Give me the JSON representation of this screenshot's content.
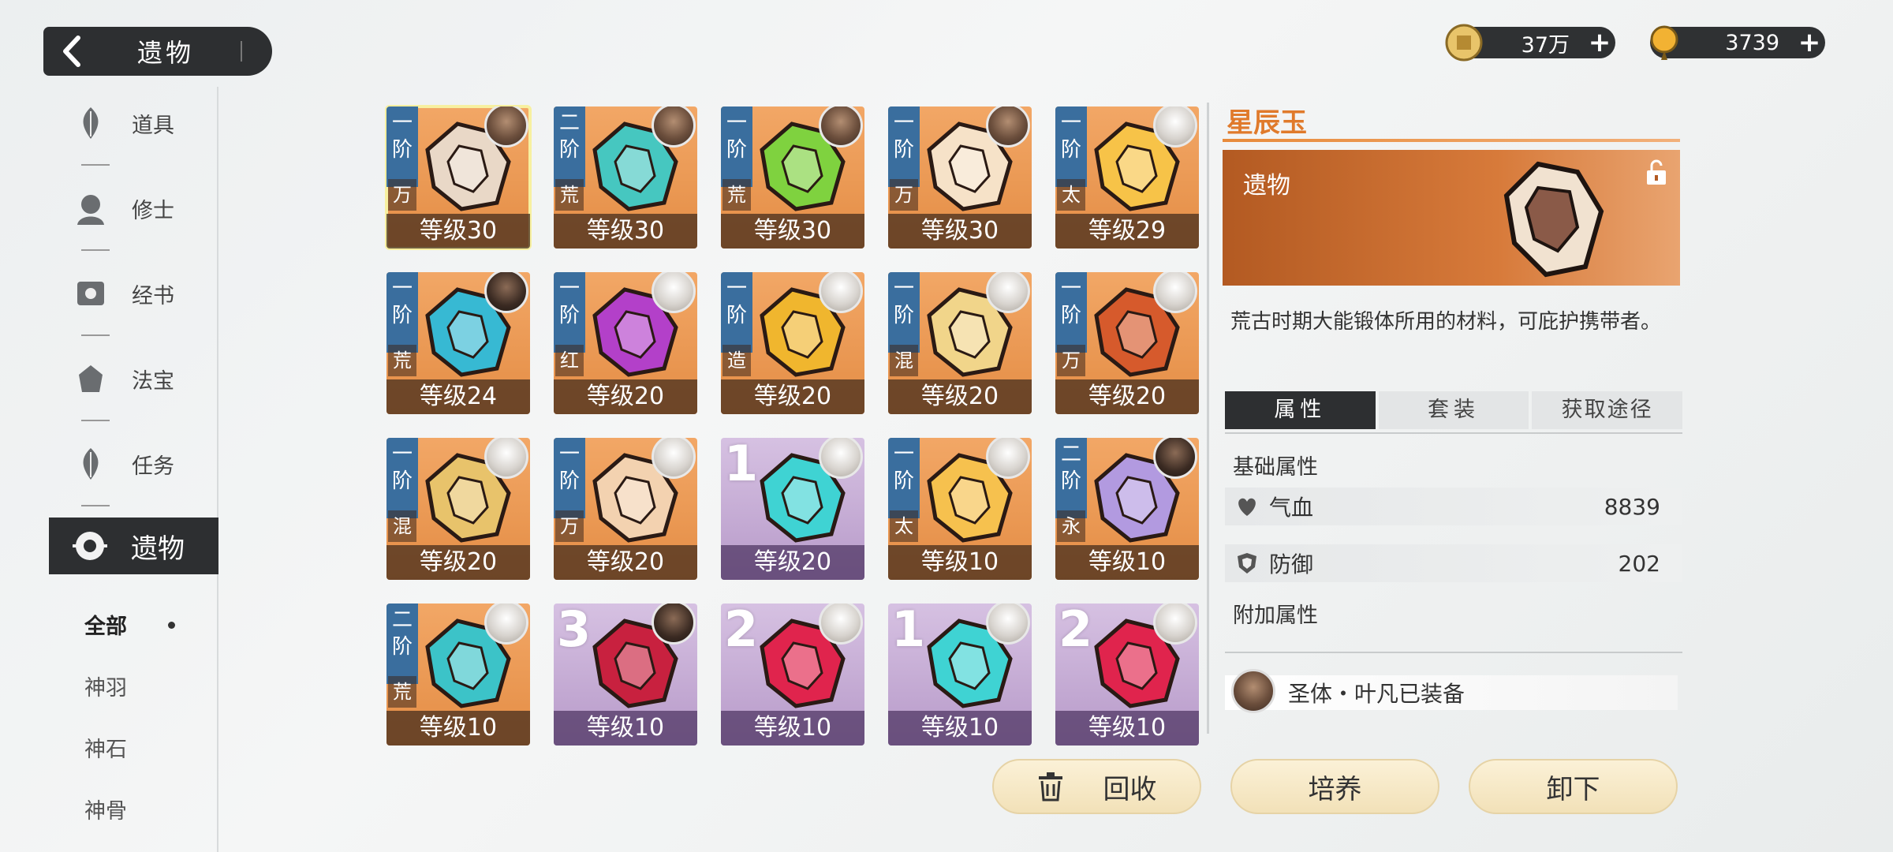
{
  "header": {
    "title": "遗物"
  },
  "currencies": [
    {
      "icon": "gold-coin-icon",
      "value": "37万"
    },
    {
      "icon": "gem-drop-icon",
      "value": "3739"
    }
  ],
  "sidebar": {
    "items": [
      {
        "label": "道具",
        "icon": "leaf-icon"
      },
      {
        "label": "修士",
        "icon": "cultivator-icon"
      },
      {
        "label": "经书",
        "icon": "scroll-icon"
      },
      {
        "label": "法宝",
        "icon": "treasure-icon"
      },
      {
        "label": "任务",
        "icon": "leaf-icon"
      },
      {
        "label": "遗物",
        "icon": "relic-icon"
      }
    ],
    "subitems": [
      "全部",
      "神羽",
      "神石",
      "神骨"
    ]
  },
  "grid": [
    {
      "tier": "一阶",
      "tag": "万",
      "level": "等级30",
      "color": "orange",
      "selected": true,
      "avatar": "brown",
      "art": "#e9d8c7"
    },
    {
      "tier": "二阶",
      "tag": "荒",
      "level": "等级30",
      "color": "orange",
      "avatar": "brown",
      "art": "#46c7c0"
    },
    {
      "tier": "一阶",
      "tag": "荒",
      "level": "等级30",
      "color": "orange",
      "avatar": "brown",
      "art": "#7fd23f"
    },
    {
      "tier": "一阶",
      "tag": "万",
      "level": "等级30",
      "color": "orange",
      "avatar": "brown",
      "art": "#f6e2c8"
    },
    {
      "tier": "一阶",
      "tag": "太",
      "level": "等级29",
      "color": "orange",
      "avatar": "light",
      "art": "#f7c348"
    },
    {
      "tier": "一阶",
      "tag": "荒",
      "level": "等级24",
      "color": "orange",
      "avatar": "dark",
      "art": "#37b9d3"
    },
    {
      "tier": "一阶",
      "tag": "红",
      "level": "等级20",
      "color": "orange",
      "avatar": "light",
      "art": "#b340c9"
    },
    {
      "tier": "一阶",
      "tag": "造",
      "level": "等级20",
      "color": "orange",
      "avatar": "light",
      "art": "#f0b62e"
    },
    {
      "tier": "一阶",
      "tag": "混",
      "level": "等级20",
      "color": "orange",
      "avatar": "light",
      "art": "#f1d58a"
    },
    {
      "tier": "一阶",
      "tag": "万",
      "level": "等级20",
      "color": "orange",
      "avatar": "light",
      "art": "#d65a2c"
    },
    {
      "tier": "一阶",
      "tag": "混",
      "level": "等级20",
      "color": "orange",
      "avatar": "light",
      "art": "#e8c36b"
    },
    {
      "tier": "一阶",
      "tag": "万",
      "level": "等级20",
      "color": "orange",
      "avatar": "light",
      "art": "#f3d2b0"
    },
    {
      "num": "1",
      "level": "等级20",
      "color": "purple",
      "avatar": "light",
      "art": "#3fd3d3"
    },
    {
      "tier": "一阶",
      "tag": "太",
      "level": "等级10",
      "color": "orange",
      "avatar": "light",
      "art": "#f6c14e"
    },
    {
      "tier": "二阶",
      "tag": "永",
      "level": "等级10",
      "color": "orange",
      "avatar": "dark",
      "art": "#b29ae0"
    },
    {
      "tier": "二阶",
      "tag": "荒",
      "level": "等级10",
      "color": "orange",
      "avatar": "light",
      "art": "#3cc3c8"
    },
    {
      "num": "3",
      "level": "等级10",
      "color": "purple",
      "avatar": "dark",
      "art": "#c8213f"
    },
    {
      "num": "2",
      "level": "等级10",
      "color": "purple",
      "avatar": "light",
      "art": "#e0244d"
    },
    {
      "num": "1",
      "level": "等级10",
      "color": "purple",
      "avatar": "light",
      "art": "#3fd3d3"
    },
    {
      "num": "2",
      "level": "等级10",
      "color": "purple",
      "avatar": "light",
      "art": "#e0244d"
    }
  ],
  "detail": {
    "name": "星辰玉",
    "type": "遗物",
    "description": "荒古时期大能锻体所用的材料，可庇护携带者。",
    "tabs": [
      "属性",
      "套装",
      "获取途径"
    ],
    "base_title": "基础属性",
    "stats": [
      {
        "icon": "heart-icon",
        "name": "气血",
        "value": "8839"
      },
      {
        "icon": "shield-icon",
        "name": "防御",
        "value": "202"
      }
    ],
    "extra_title": "附加属性",
    "equipped": "圣体・叶凡已装备"
  },
  "buttons": {
    "recycle": "回收",
    "cultivate": "培养",
    "unequip": "卸下"
  },
  "colors": {
    "accent": "#e07a2b",
    "dark": "#2d2f31",
    "card_orange": "#e48d45",
    "card_purple": "#b79ac9"
  }
}
